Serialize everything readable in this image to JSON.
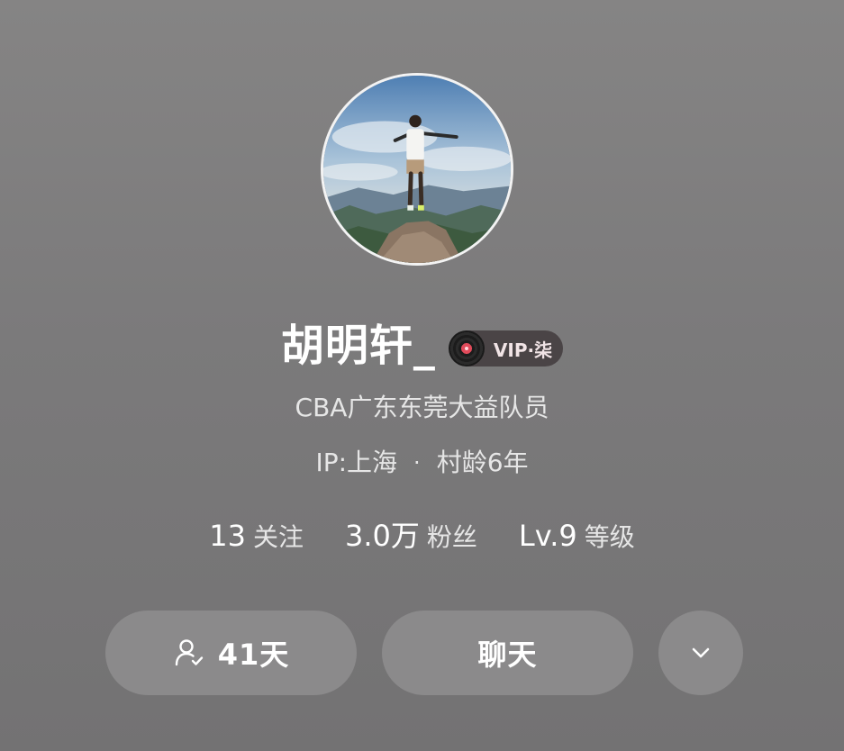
{
  "profile": {
    "username": "胡明轩_",
    "vip_label": "VIP·柒",
    "bio": "CBA广东东莞大益队员",
    "ip_location": "IP:上海",
    "separator": "·",
    "account_age": "村龄6年"
  },
  "stats": [
    {
      "value": "13",
      "label": "关注"
    },
    {
      "value": "3.0万",
      "label": "粉丝"
    },
    {
      "value": "Lv.9",
      "label": "等级"
    }
  ],
  "actions": {
    "days_label": "41天",
    "chat_label": "聊天",
    "more_icon": "chevron-down-icon",
    "days_icon": "user-check-icon"
  },
  "colors": {
    "background": "#777677",
    "button": "#8b8a8b",
    "vip_badge": "#4a4446",
    "vip_disc_center": "#e04a5a"
  }
}
